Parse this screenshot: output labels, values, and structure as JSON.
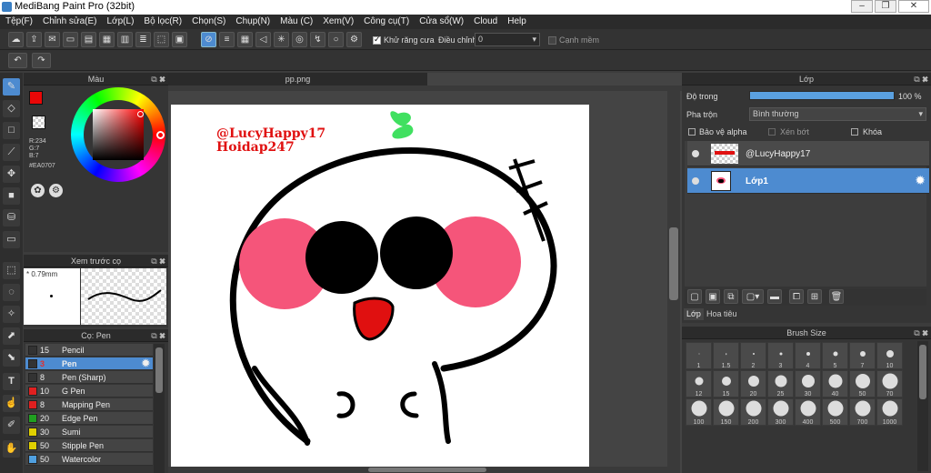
{
  "window": {
    "title": "MediBang Paint Pro (32bit)"
  },
  "menu": [
    "Tệp(F)",
    "Chỉnh sửa(E)",
    "Lớp(L)",
    "Bộ lọc(R)",
    "Chọn(S)",
    "Chụp(N)",
    "Màu (C)",
    "Xem(V)",
    "Công cụ(T)",
    "Cửa sổ(W)",
    "Cloud",
    "Help"
  ],
  "toolbar": {
    "antialias_label": "Khử răng cưa",
    "adjust_label": "Điều chỉnh",
    "adjust_value": "0",
    "sharp_edge_label": "Cạnh mềm"
  },
  "color_panel": {
    "title": "Màu",
    "fg_color": "#EA0707",
    "r": "R:234",
    "g": "G:7",
    "b": "B:7",
    "hex": "#EA0707"
  },
  "brush_preview": {
    "title": "Xem trước cọ",
    "size": "0.79mm"
  },
  "brush_list": {
    "title": "Cọ: Pen",
    "items": [
      {
        "size": "15",
        "name": "Pencil",
        "color": "#333333"
      },
      {
        "size": "3",
        "name": "Pen",
        "color": "#333333"
      },
      {
        "size": "8",
        "name": "Pen (Sharp)",
        "color": "#333333"
      },
      {
        "size": "10",
        "name": "G Pen",
        "color": "#e02020"
      },
      {
        "size": "8",
        "name": "Mapping Pen",
        "color": "#e02020"
      },
      {
        "size": "20",
        "name": "Edge Pen",
        "color": "#20a020"
      },
      {
        "size": "30",
        "name": "Sumi",
        "color": "#e0d000"
      },
      {
        "size": "50",
        "name": "Stipple Pen",
        "color": "#e0d000"
      },
      {
        "size": "50",
        "name": "Watercolor",
        "color": "#50a0e0"
      }
    ]
  },
  "canvas": {
    "tab": "pp.png",
    "watermark1": "@LucyHappy17",
    "watermark2": "Hoidap247"
  },
  "layer_panel": {
    "title": "Lớp",
    "opacity_label": "Độ trong",
    "opacity_value": "100 %",
    "blend_label": "Pha trộn",
    "blend_value": "Bình thường",
    "protect_alpha": "Bảo vệ alpha",
    "clip": "Xén bớt",
    "lock": "Khóa",
    "layers": [
      {
        "name": "@LucyHappy17"
      },
      {
        "name": "Lớp1"
      }
    ],
    "tabs": [
      "Lớp",
      "Hoa tiêu"
    ]
  },
  "brush_size": {
    "title": "Brush Size",
    "sizes": [
      "1",
      "1.5",
      "2",
      "3",
      "4",
      "5",
      "7",
      "10",
      "12",
      "15",
      "20",
      "25",
      "30",
      "40",
      "50",
      "70",
      "100",
      "150",
      "200",
      "300",
      "400",
      "500",
      "700",
      "1000"
    ]
  },
  "colors": {
    "accent": "#4d8bd0",
    "cheek": "#f5557a",
    "mouth": "#e01010",
    "sprout": "#40e060"
  }
}
